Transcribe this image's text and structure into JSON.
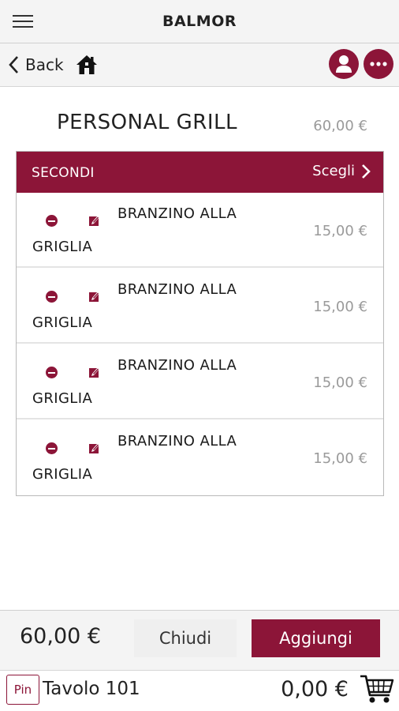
{
  "header": {
    "title": "BALMOR",
    "menu_icon": "hamburger-menu-icon"
  },
  "nav": {
    "back_label": "Back",
    "back_icon": "chevron-left-icon",
    "home_icon": "home-icon",
    "user_icon": "user-icon",
    "more_icon": "more-dots-icon"
  },
  "product": {
    "title": "PERSONAL GRILL",
    "price": "60,00 €"
  },
  "group": {
    "name": "SECONDI",
    "choose_label": "Scegli",
    "items": [
      {
        "name_line1": "BRANZINO ALLA",
        "name_line2": "GRIGLIA",
        "price": "15,00 €"
      },
      {
        "name_line1": "BRANZINO ALLA",
        "name_line2": "GRIGLIA",
        "price": "15,00 €"
      },
      {
        "name_line1": "BRANZINO ALLA",
        "name_line2": "GRIGLIA",
        "price": "15,00 €"
      },
      {
        "name_line1": "BRANZINO ALLA",
        "name_line2": "GRIGLIA",
        "price": "15,00 €"
      }
    ]
  },
  "footer": {
    "total": "60,00 €",
    "close_label": "Chiudi",
    "add_label": "Aggiungi"
  },
  "bottom": {
    "pin_label": "Pin",
    "table": "Tavolo 101",
    "cart_total": "0,00 €",
    "cart_icon": "cart-icon"
  },
  "colors": {
    "accent": "#8c1538",
    "muted_text": "#9a9a9a",
    "bar_bg": "#f4f4f4"
  }
}
